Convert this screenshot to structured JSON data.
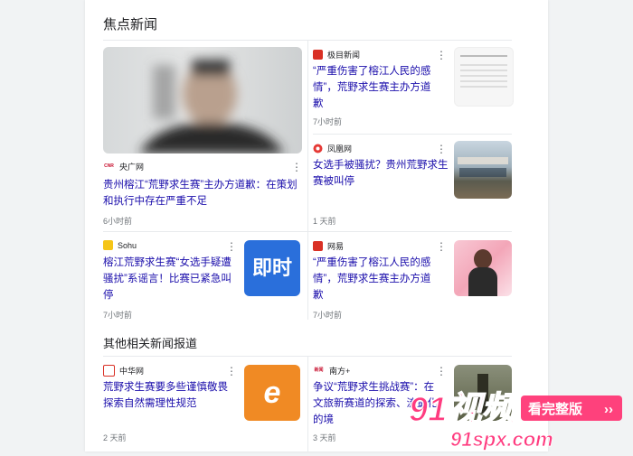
{
  "focus": {
    "section_title": "焦点新闻",
    "cards": [
      {
        "source": "央广网",
        "title": "贵州榕江“荒野求生赛”主办方道歉：在策划和执行中存在严重不足",
        "time": "6小时前"
      },
      {
        "source": "极目新闻",
        "title": "“严重伤害了榕江人民的感情”，荒野求生赛主办方道歉",
        "time": "7小时前"
      },
      {
        "source": "凤凰网",
        "title": "女选手被骚扰？贵州荒野求生赛被叫停",
        "time": "1 天前"
      },
      {
        "source": "Sohu",
        "title": "榕江荒野求生赛“女选手疑遭骚扰”系谣言！比赛已紧急叫停",
        "time": "7小时前",
        "thumb_text": "即时"
      },
      {
        "source": "网易",
        "title": "“严重伤害了榕江人民的感情”，荒野求生赛主办方道歉",
        "time": "7小时前"
      }
    ]
  },
  "other": {
    "section_title": "其他相关新闻报道",
    "cards": [
      {
        "source": "中华网",
        "title": "荒野求生赛要多些谨慎敬畏 探索自然需理性规范",
        "time": "2 天前",
        "thumb_text": "e"
      },
      {
        "source": "南方+",
        "title": "争议“荒野求生挑战赛”：在文旅新赛道的探索、流量化的境",
        "time": "3 天前"
      }
    ]
  },
  "logos": {
    "cnr": "CNR",
    "hunan": "新闻"
  },
  "watermark": {
    "brand": "91视频",
    "tagline": "看完整版",
    "url": "91spx.com"
  }
}
